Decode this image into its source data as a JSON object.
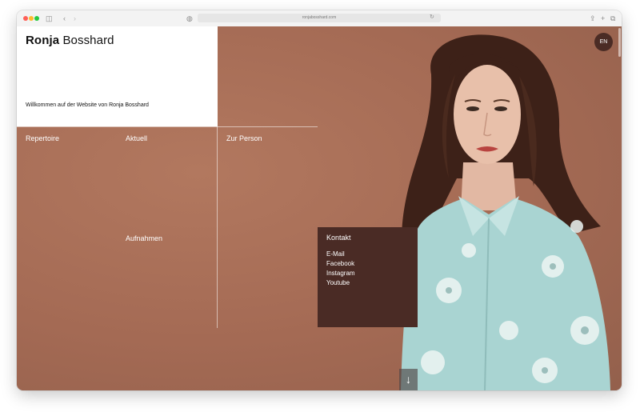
{
  "browser": {
    "url": "ronjabosshard.com",
    "icons": [
      "sidebar-icon",
      "back-icon",
      "forward-icon",
      "shield-icon",
      "share-icon",
      "new-tab-icon",
      "tabs-icon"
    ]
  },
  "site": {
    "name_first": "Ronja",
    "name_last": " Bosshard",
    "welcome": "Willkommen auf der Website von Ronja Bosshard",
    "language": "EN"
  },
  "nav": {
    "repertoire": "Repertoire",
    "aktuell": "Aktuell",
    "zur_person": "Zur Person",
    "aufnahmen": "Aufnahmen"
  },
  "kontakt": {
    "title": "Kontakt",
    "links": [
      "E-Mail",
      "Facebook",
      "Instagram",
      "Youtube"
    ]
  },
  "scroll_down": "↓",
  "colors": {
    "background": "#a46a55",
    "kontakt_box": "#4a2b25",
    "language_badge": "#4b2c25",
    "blouse": "#a9d4d2"
  }
}
